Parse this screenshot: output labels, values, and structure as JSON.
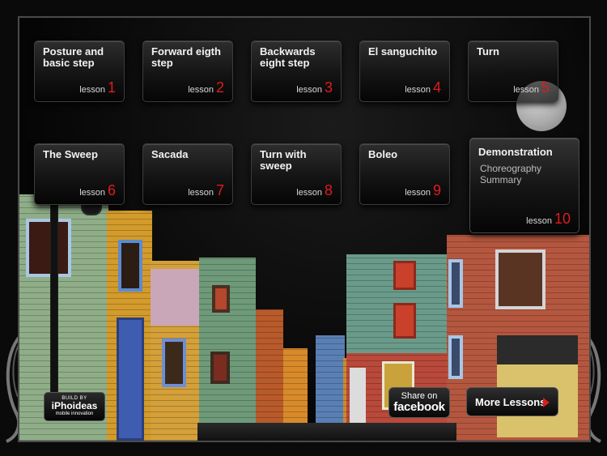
{
  "lessons": [
    {
      "title": "Posture and basic step",
      "lesson_word": "lesson",
      "number": "1"
    },
    {
      "title": "Forward eigth step",
      "lesson_word": "lesson",
      "number": "2"
    },
    {
      "title": "Backwards eight step",
      "lesson_word": "lesson",
      "number": "3"
    },
    {
      "title": "El sanguchito",
      "lesson_word": "lesson",
      "number": "4"
    },
    {
      "title": "Turn",
      "lesson_word": "lesson",
      "number": "5"
    },
    {
      "title": "The Sweep",
      "lesson_word": "lesson",
      "number": "6"
    },
    {
      "title": "Sacada",
      "lesson_word": "lesson",
      "number": "7"
    },
    {
      "title": "Turn with sweep",
      "lesson_word": "lesson",
      "number": "8"
    },
    {
      "title": "Boleo",
      "lesson_word": "lesson",
      "number": "9"
    },
    {
      "title": "Demonstration",
      "subtitle_1": "Choreography",
      "subtitle_2": "Summary",
      "lesson_word": "lesson",
      "number": "10"
    }
  ],
  "share": {
    "line1": "Share on",
    "line2": "facebook"
  },
  "more_lessons": {
    "label": "More Lessons"
  },
  "badge": {
    "line1": "BUILD BY",
    "line2": "iPhoideas",
    "line3": "mobile innovation"
  },
  "colors": {
    "accent_red": "#e01b1b",
    "tile_text": "#f2f2f2"
  }
}
